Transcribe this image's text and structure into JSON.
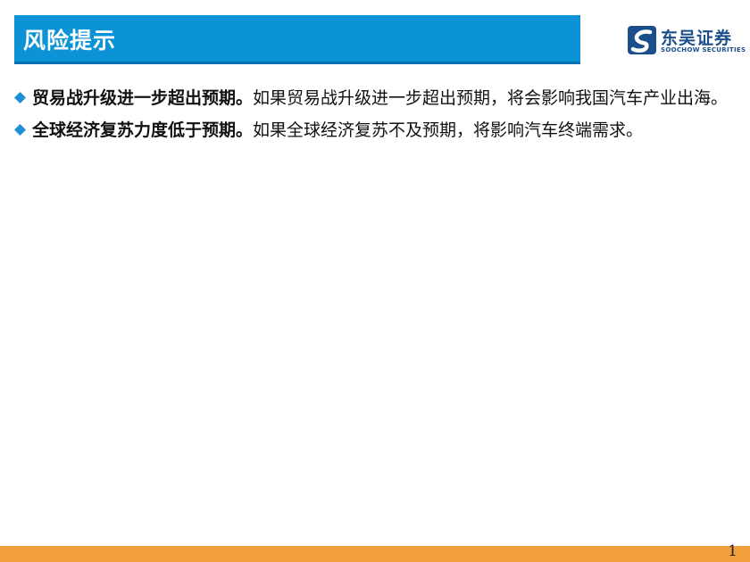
{
  "header": {
    "title": "风险提示"
  },
  "logo": {
    "name_cn": "东吴证券",
    "name_en": "SOOCHOW SECURITIES",
    "mark_icon": "soochow-logo-icon"
  },
  "bullets": [
    {
      "bold": "贸易战升级进一步超出预期。",
      "text": "如果贸易战升级进一步超出预期，将会影响我国汽车产业出海。"
    },
    {
      "bold": "全球经济复苏力度低于预期。",
      "text": "如果全球经济复苏不及预期，将影响汽车终端需求。"
    }
  ],
  "footer": {
    "page_number": "1"
  },
  "colors": {
    "header_blue": "#0b93d6",
    "bullet_blue": "#1e8fd5",
    "footer_orange": "#f2a03d",
    "logo_navy": "#1a4f8c"
  }
}
